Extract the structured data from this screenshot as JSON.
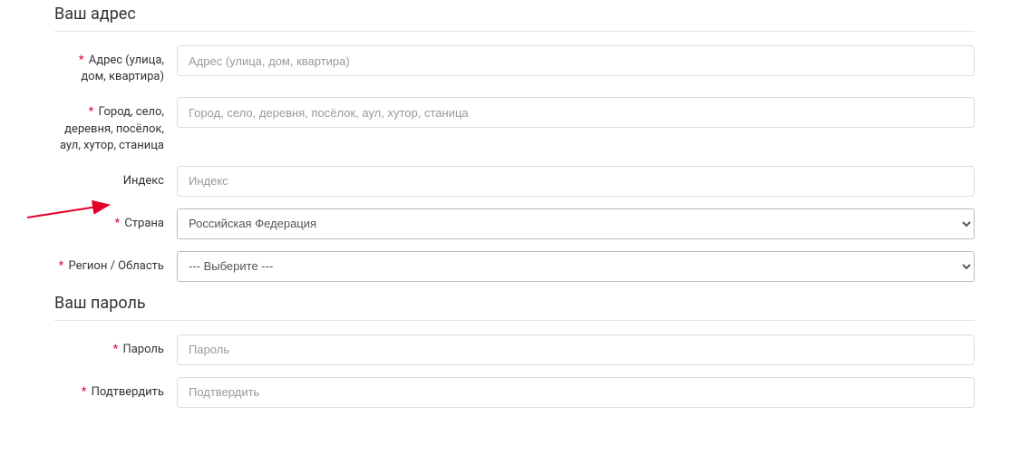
{
  "address_section": {
    "title": "Ваш адрес",
    "fields": {
      "address": {
        "label": "Адрес (улица, дом, квартира)",
        "placeholder": "Адрес (улица, дом, квартира)",
        "required": true
      },
      "city": {
        "label": "Город, село, деревня, посёлок, аул, хутор, станица",
        "placeholder": "Город, село, деревня, посёлок, аул, хутор, станица",
        "required": true
      },
      "index": {
        "label": "Индекс",
        "placeholder": "Индекс",
        "required": false
      },
      "country": {
        "label": "Страна",
        "selected": "Российская Федерация",
        "required": true
      },
      "region": {
        "label": "Регион / Область",
        "selected": " --- Выберите --- ",
        "required": true
      }
    }
  },
  "password_section": {
    "title": "Ваш пароль",
    "fields": {
      "password": {
        "label": "Пароль",
        "placeholder": "Пароль",
        "required": true
      },
      "confirm": {
        "label": "Подтвердить",
        "placeholder": "Подтвердить",
        "required": true
      }
    }
  },
  "req_marker": "*"
}
